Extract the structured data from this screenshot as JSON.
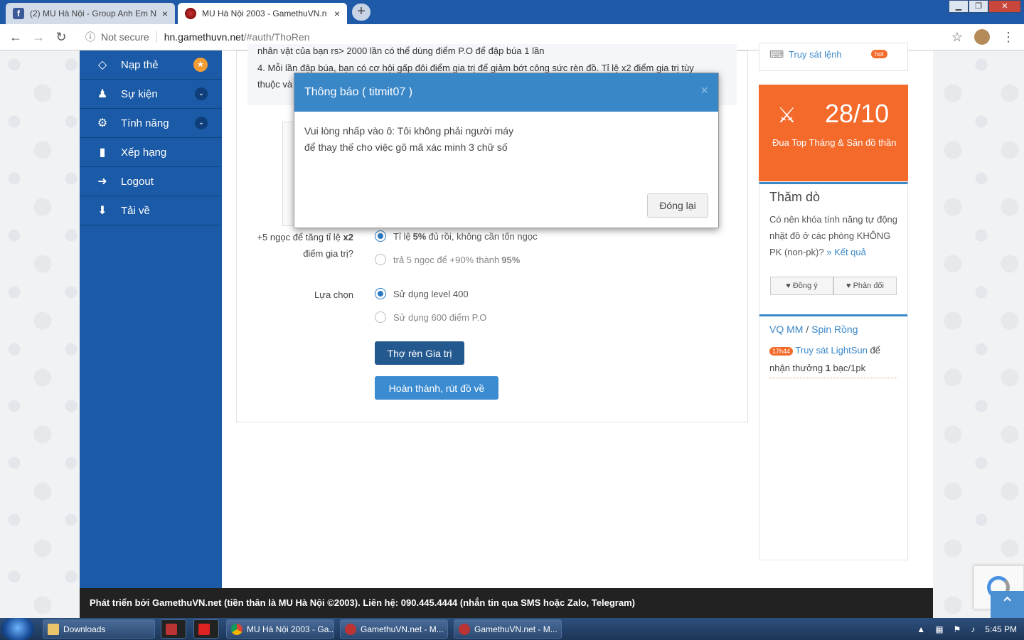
{
  "browser": {
    "tabs": [
      {
        "title": "(2) MU Hà Nội - Group Anh Em N",
        "close": "×"
      },
      {
        "title": "MU Hà Nội 2003 - GamethuVN.n",
        "close": "×"
      }
    ],
    "new_tab": "+",
    "window_controls": [
      "▁",
      "❐",
      "✕"
    ],
    "nav": {
      "back": "←",
      "forward": "→",
      "reload": "↻"
    },
    "address": {
      "info": "ⓘ",
      "security": "Not secure",
      "domain": "hn.gamethuvn.net",
      "path": "/#auth/ThoRen"
    },
    "bookmark_star": "☆",
    "menu": "⋮"
  },
  "sidebar": {
    "items": [
      {
        "label": "Nạp thẻ",
        "icon": "◇",
        "badge": "★"
      },
      {
        "label": "Sự kiện",
        "icon": "♟",
        "chevron": "⌄"
      },
      {
        "label": "Tính năng",
        "icon": "⚙",
        "chevron": "⌄"
      },
      {
        "label": "Xếp hạng",
        "icon": "▮"
      },
      {
        "label": "Logout",
        "icon": "➜"
      },
      {
        "label": "Tải về",
        "icon": "⬇"
      }
    ]
  },
  "main": {
    "note_line1": "nhân vật của bạn rs> 2000 lần có thể dùng điểm P.O để đập búa 1 lần",
    "note_line2": "4. Mỗi lần đập búa, bạn có cơ hội gấp đôi điểm gia trị để giảm bớt công sức rèn đồ. Tỉ lệ x2 điểm gia trị tùy",
    "note_line3": "thuộc và",
    "gem_label_1": "+5 ngọc để tăng tỉ lệ ",
    "gem_label_bold": "x2",
    "gem_label_2": "điểm gia trị?",
    "gem_options": [
      {
        "pre": "Tỉ lệ ",
        "bold": "5%",
        "post": " đủ rồi, không cần tốn ngọc"
      },
      {
        "pre": "trả 5 ngọc để +90% thành ",
        "bold": "95%",
        "post": ""
      }
    ],
    "choice_label": "Lựa chọn",
    "choice_options": [
      "Sử dụng level 400",
      "Sử dụng 600 điểm P.O"
    ],
    "btn_forge": "Thợ rèn Gia trị",
    "btn_finish": "Hoàn thành, rút đồ về"
  },
  "right": {
    "top_link": "Truy sát lệnh",
    "top_badge": "hot",
    "promo_date": "28/10",
    "promo_text": "Đua Top Tháng & Săn đồ thần",
    "poll_title": "Thăm dò",
    "poll_question": "Có nên khóa tính năng tự động nhặt đồ ở các phòng KHÔNG PK (non-pk)?",
    "poll_result": "» Kết quả",
    "poll_agree": "♥ Đồng ý",
    "poll_disagree": "♥ Phản đối",
    "vq_title_1": "VQ MM",
    "vq_sep": " / ",
    "vq_title_2": "Spin Rồng",
    "event_time": "17h44",
    "event_link": "Truy sát LightSun",
    "event_text_1": " để nhận thưởng ",
    "event_bold": "1",
    "event_text_2": " bạc/1pk"
  },
  "footer": "Phát triển bởi GamethuVN.net (tiền thân là MU Hà Nội ©2003). Liên hệ: 090.445.4444 (nhắn tin qua SMS hoặc Zalo, Telegram)",
  "modal": {
    "title": "Thông báo ( titmit07 )",
    "close": "×",
    "line1": "Vui lòng nhấp vào ô: Tôi không phải người máy",
    "line2": "để thay thế cho việc gõ mã xác minh 3 chữ số",
    "button": "Đóng lại"
  },
  "scroll_top": "⌃",
  "taskbar": {
    "items": [
      "Downloads",
      "MU Hà Nội 2003 - Ga...",
      "GamethuVN.net - M...",
      "GamethuVN.net - M..."
    ],
    "clock": "5:45 PM"
  },
  "colors": {
    "primary": "#1a5aa6",
    "accent": "#f36a2b",
    "modal_header": "#3a87c8",
    "button": "#2e6db0"
  }
}
